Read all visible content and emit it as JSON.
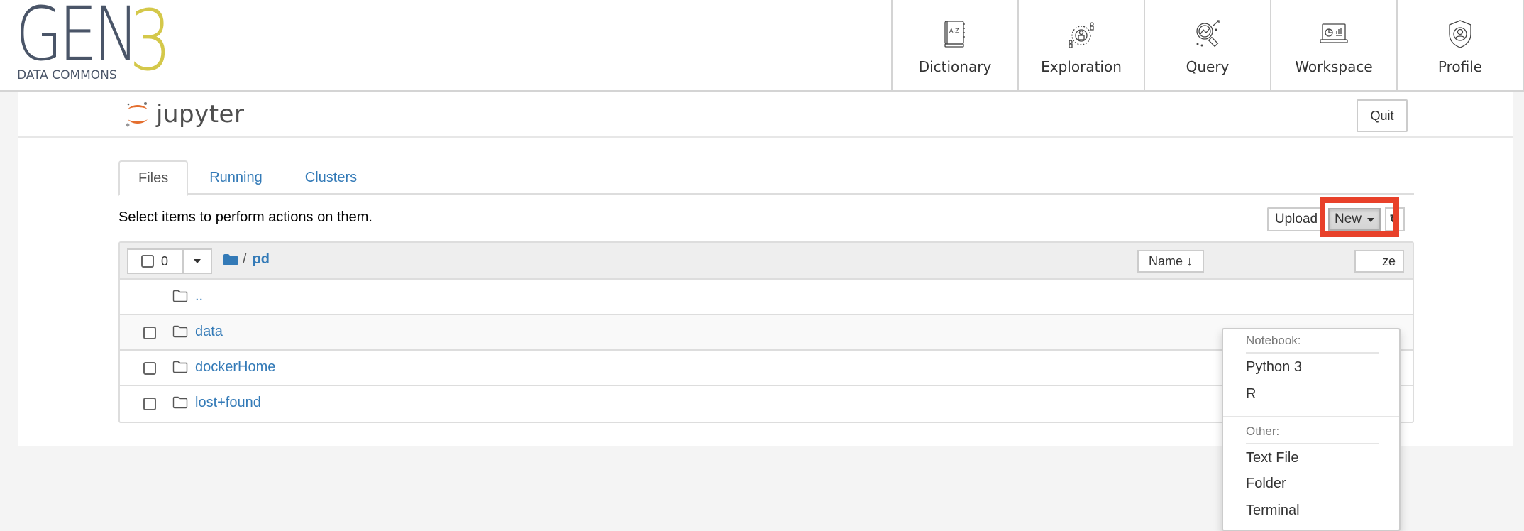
{
  "gen3": {
    "logo_main": "GEN",
    "logo_number": "3",
    "logo_sub": "DATA COMMONS",
    "nav": [
      {
        "label": "Dictionary",
        "icon": "dictionary-book-icon"
      },
      {
        "label": "Exploration",
        "icon": "exploration-icon"
      },
      {
        "label": "Query",
        "icon": "query-magnifier-icon"
      },
      {
        "label": "Workspace",
        "icon": "workspace-laptop-icon"
      },
      {
        "label": "Profile",
        "icon": "profile-shield-icon"
      }
    ]
  },
  "jupyter": {
    "logo_text": "jupyter",
    "quit_label": "Quit",
    "tabs": [
      {
        "label": "Files",
        "active": true
      },
      {
        "label": "Running",
        "active": false
      },
      {
        "label": "Clusters",
        "active": false
      }
    ],
    "select_message": "Select items to perform actions on them.",
    "upload_label": "Upload",
    "new_label": "New",
    "refresh_icon": "↻",
    "selected_count": "0",
    "breadcrumb_separator": "/",
    "current_dir": "pd",
    "sort_name_label": "Name ↓",
    "sort_size_label": "ze",
    "files": [
      {
        "name": "..",
        "type": "folder",
        "checkbox": false
      },
      {
        "name": "data",
        "type": "folder",
        "checkbox": true
      },
      {
        "name": "dockerHome",
        "type": "folder",
        "checkbox": true
      },
      {
        "name": "lost+found",
        "type": "folder",
        "checkbox": true
      }
    ],
    "new_menu": {
      "notebook_header": "Notebook:",
      "notebook_items": [
        "Python 3",
        "R"
      ],
      "other_header": "Other:",
      "other_items": [
        "Text File",
        "Folder",
        "Terminal"
      ]
    }
  },
  "colors": {
    "link": "#337ab7",
    "highlight": "#e8412a",
    "gen3_gray": "#4a5568",
    "gen3_yellow": "#d4c84a",
    "jupyter_orange": "#e46e2e"
  }
}
